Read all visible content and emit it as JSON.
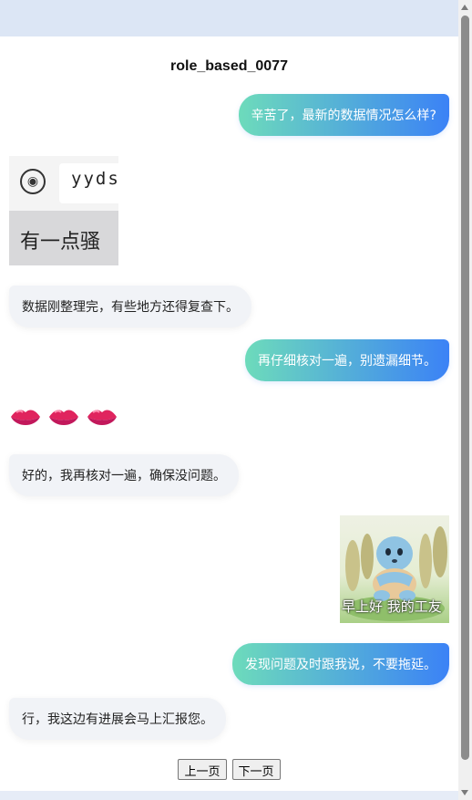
{
  "chat": {
    "title": "role_based_0077",
    "messages": [
      {
        "side": "right",
        "type": "text",
        "text": "辛苦了，最新的数据情况怎么样?"
      },
      {
        "side": "left",
        "type": "sticker",
        "sticker_text": "yyds",
        "caption": "有一点骚"
      },
      {
        "side": "left",
        "type": "text",
        "text": "数据刚整理完，有些地方还得复查下。"
      },
      {
        "side": "right",
        "type": "text",
        "text": "再仔细核对一遍，别遗漏细节。"
      },
      {
        "side": "left",
        "type": "emoji",
        "icon": "kiss-lips-icon",
        "count": 3
      },
      {
        "side": "left",
        "type": "text",
        "text": "好的，我再核对一遍，确保没问题。"
      },
      {
        "side": "right",
        "type": "sticker",
        "caption": "早上好 我的工友"
      },
      {
        "side": "right",
        "type": "text",
        "text": "发现问题及时跟我说，不要拖延。"
      },
      {
        "side": "left",
        "type": "text",
        "text": "行，我这边有进展会马上汇报您。"
      }
    ]
  },
  "pagination": {
    "prev_label": "上一页",
    "next_label": "下一页"
  },
  "colors": {
    "bubble_gradient_start": "#6ddbbb",
    "bubble_gradient_end": "#3b82f6",
    "left_bubble_bg": "#f1f3f7",
    "lips": "#e0245e"
  }
}
